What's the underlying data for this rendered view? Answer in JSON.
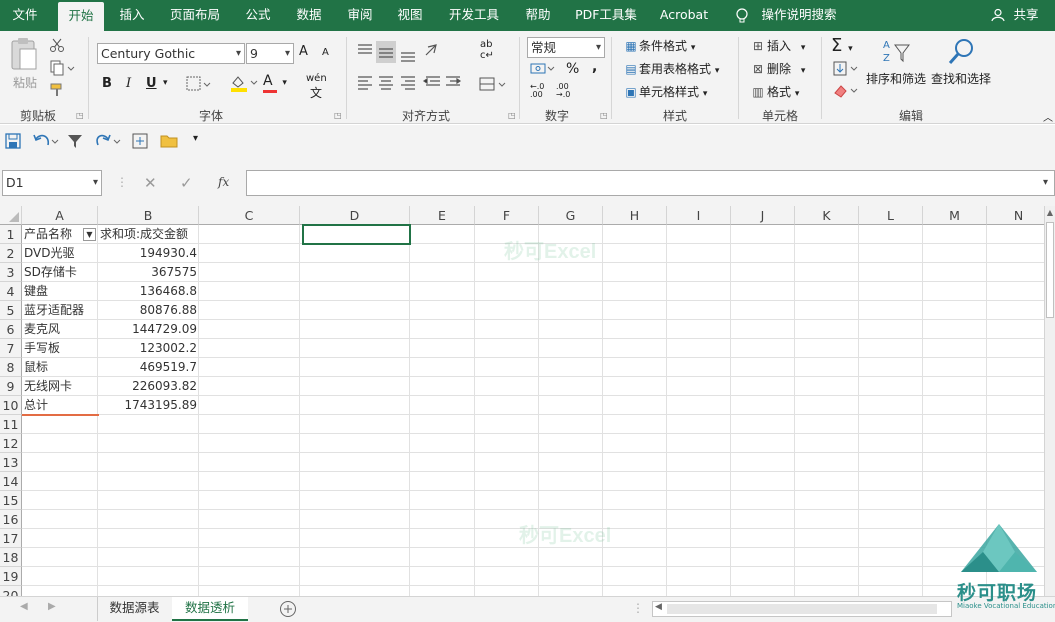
{
  "tabs": [
    "文件",
    "开始",
    "插入",
    "页面布局",
    "公式",
    "数据",
    "审阅",
    "视图",
    "开发工具",
    "帮助",
    "PDF工具集",
    "Acrobat"
  ],
  "active_tab": "开始",
  "tell_me": "操作说明搜索",
  "share": "共享",
  "ribbon": {
    "clipboard": {
      "paste": "粘贴",
      "label": "剪贴板"
    },
    "font": {
      "name": "Century Gothic",
      "size": "9",
      "bold": "B",
      "italic": "I",
      "underline": "U",
      "label": "字体",
      "wen": "wén",
      "grow": "A",
      "shrink": "A",
      "font_color": "A"
    },
    "align": {
      "label": "对齐方式"
    },
    "number": {
      "format": "常规",
      "label": "数字",
      "percent": "%",
      "comma": ","
    },
    "styles": {
      "cond": "条件格式",
      "table": "套用表格格式",
      "cell": "单元格样式",
      "label": "样式"
    },
    "cells": {
      "insert": "插入",
      "delete": "删除",
      "format": "格式",
      "label": "单元格"
    },
    "editing": {
      "sort": "排序和筛选",
      "find": "查找和选择",
      "label": "编辑"
    }
  },
  "name_box": "D1",
  "formula_value": "",
  "columns": [
    "A",
    "B",
    "C",
    "D",
    "E",
    "F",
    "G",
    "H",
    "I",
    "J",
    "K",
    "L",
    "M",
    "N"
  ],
  "rows": [
    "1",
    "2",
    "3",
    "4",
    "5",
    "6",
    "7",
    "8",
    "9",
    "10",
    "11",
    "12",
    "13",
    "14",
    "15",
    "16",
    "17",
    "18",
    "19",
    "20"
  ],
  "pivot": {
    "header_a": "产品名称",
    "header_b": "求和项:成交金额",
    "items": [
      {
        "name": "DVD光驱",
        "value": "194930.4"
      },
      {
        "name": "SD存储卡",
        "value": "367575"
      },
      {
        "name": "键盘",
        "value": "136468.8"
      },
      {
        "name": "蓝牙适配器",
        "value": "80876.88"
      },
      {
        "name": "麦克风",
        "value": "144729.09"
      },
      {
        "name": "手写板",
        "value": "123002.2"
      },
      {
        "name": "鼠标",
        "value": "469519.7"
      },
      {
        "name": "无线网卡",
        "value": "226093.82"
      }
    ],
    "total_label": "总计",
    "total_value": "1743195.89"
  },
  "watermark": "秒可Excel",
  "sheets": [
    "数据源表",
    "数据透析"
  ],
  "active_sheet": "数据透析",
  "brand": {
    "name": "秒可职场",
    "sub": "Miaoke Vocational Education"
  },
  "colors": {
    "excel_green": "#217346",
    "accent_orange": "#e36c44"
  }
}
